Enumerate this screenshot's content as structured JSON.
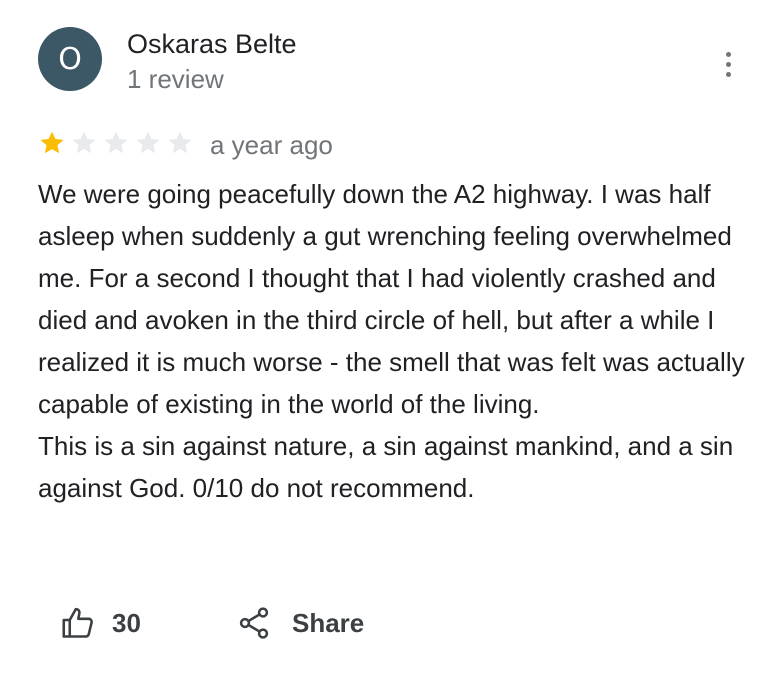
{
  "reviewer": {
    "initial": "O",
    "name": "Oskaras Belte",
    "review_count": "1 review",
    "avatar_color": "#3c5866"
  },
  "rating": {
    "stars": 1,
    "max": 5,
    "filled_color": "#fbbc04",
    "empty_color": "#e8eaed"
  },
  "time_ago": "a year ago",
  "review": {
    "paragraphs": [
      "We were going peacefully down the A2 highway. I was half asleep when suddenly a gut wrenching feeling overwhelmed me. For a second I thought that I had violently crashed and died and avoken in the third circle of hell, but after a while I realized it is much worse - the smell that was felt was actually capable of existing in the world of the living.",
      "This is a sin against nature, a sin against mankind, and a sin against God. 0/10 do not recommend."
    ]
  },
  "actions": {
    "like_icon": "thumb-up-icon",
    "like_count": "30",
    "share_icon": "share-icon",
    "share_label": "Share"
  },
  "menu_icon": "more-vertical-icon"
}
